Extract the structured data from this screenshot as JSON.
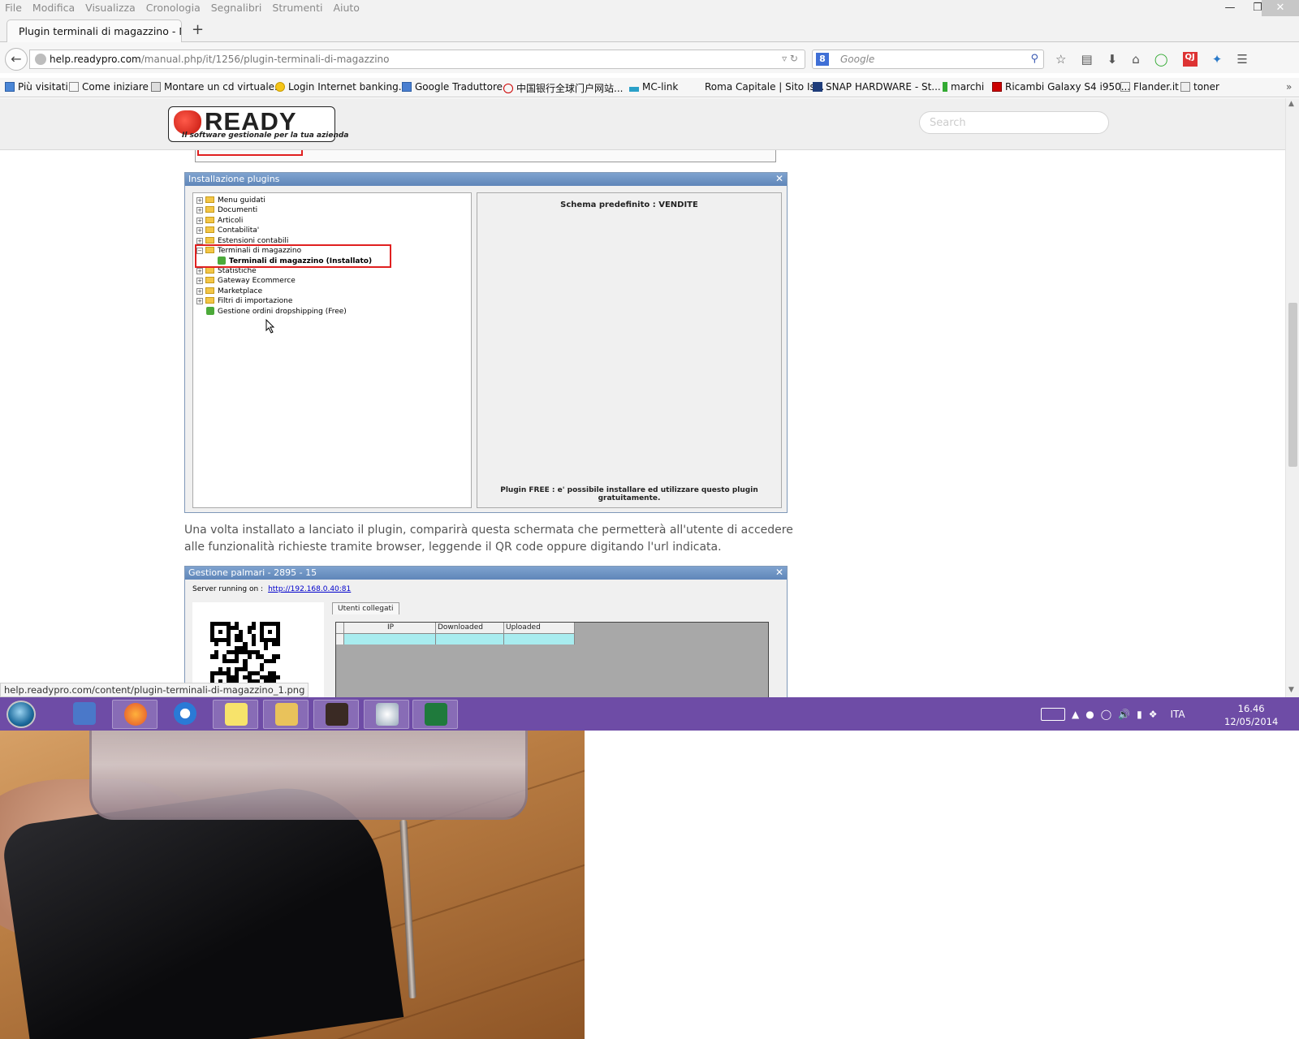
{
  "browser": {
    "menu": [
      "File",
      "Modifica",
      "Visualizza",
      "Cronologia",
      "Segnalibri",
      "Strumenti",
      "Aiuto"
    ],
    "tab_title": "Plugin terminali di magazzino - M...",
    "url_host": "help.readypro.com",
    "url_path": "/manual.php/it/1256/plugin-terminali-di-magazzino",
    "search_placeholder": "Google",
    "bookmarks": [
      "Più visitati",
      "Come iniziare",
      "Montare un cd virtuale...",
      "Login Internet banking...",
      "Google Traduttore",
      "中国银行全球门户网站...",
      "MC-link",
      "Roma Capitale | Sito Is...",
      "SNAP HARDWARE - St...",
      "marchi",
      "Ricambi Galaxy S4 i950...",
      "Flander.it",
      "toner"
    ],
    "status_link": "help.readypro.com/content/plugin-terminali-di-magazzino_1.png"
  },
  "site": {
    "logo_word": "READY",
    "logo_tagline": "Il software gestionale per la tua azienda",
    "search_placeholder": "Search"
  },
  "dialog1": {
    "title": "Installazione plugins",
    "tree": [
      {
        "label": "Menu guidati",
        "expander": "+"
      },
      {
        "label": "Documenti",
        "expander": "+"
      },
      {
        "label": "Articoli",
        "expander": "+"
      },
      {
        "label": "Contabilita'",
        "expander": "+"
      },
      {
        "label": "Estensioni contabili",
        "expander": "+"
      },
      {
        "label": "Terminali di magazzino",
        "expander": "-"
      },
      {
        "label": "Terminali di magazzino (Installato)",
        "child": true
      },
      {
        "label": "Statistiche",
        "expander": "+"
      },
      {
        "label": "Gateway Ecommerce",
        "expander": "+"
      },
      {
        "label": "Marketplace",
        "expander": "+"
      },
      {
        "label": "Filtri di importazione",
        "expander": "+"
      },
      {
        "label": "Gestione ordini dropshipping (Free)",
        "leaf": true
      }
    ],
    "schema": "Schema predefinito : VENDITE",
    "free_note": "Plugin FREE : e' possibile installare ed utilizzare questo plugin gratuitamente."
  },
  "paragraph": "Una volta installato a lanciato il plugin, comparirà questa schermata che permetterà all'utente di accedere alle funzionalità richieste tramite browser, leggende il QR code oppure digitando l'url indicata.",
  "dialog2": {
    "title": "Gestione palmari - 2895 - 15",
    "server_label": "Server running on :",
    "server_url": "http://192.168.0.40:81",
    "tab": "Utenti collegati",
    "columns": [
      "IP",
      "Downloaded",
      "Uploaded"
    ]
  },
  "taskbar": {
    "language": "ITA",
    "time": "16.46",
    "date": "12/05/2014"
  },
  "colors": {
    "taskbar": "#6e4ca6",
    "dialog_title": "#6e93c4",
    "highlight_red": "#e02020",
    "grid_row": "#a8ecef"
  }
}
